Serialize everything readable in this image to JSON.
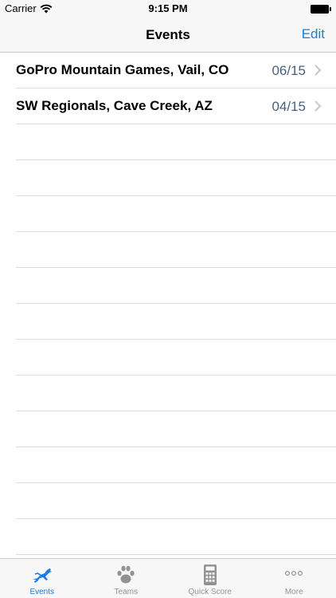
{
  "status_bar": {
    "carrier": "Carrier",
    "time": "9:15 PM"
  },
  "nav": {
    "title": "Events",
    "edit_label": "Edit"
  },
  "events": [
    {
      "title": "GoPro Mountain Games, Vail, CO",
      "date": "06/15"
    },
    {
      "title": "SW Regionals, Cave Creek, AZ",
      "date": "04/15"
    }
  ],
  "tabs": [
    {
      "label": "Events",
      "icon": "leaping-dog-icon",
      "active": true
    },
    {
      "label": "Teams",
      "icon": "paw-icon",
      "active": false
    },
    {
      "label": "Quick Score",
      "icon": "calculator-icon",
      "active": false
    },
    {
      "label": "More",
      "icon": "more-dots-icon",
      "active": false
    }
  ],
  "colors": {
    "accent": "#1a7ce6",
    "date_text": "#4a5f80",
    "inactive_tab": "#929292"
  }
}
